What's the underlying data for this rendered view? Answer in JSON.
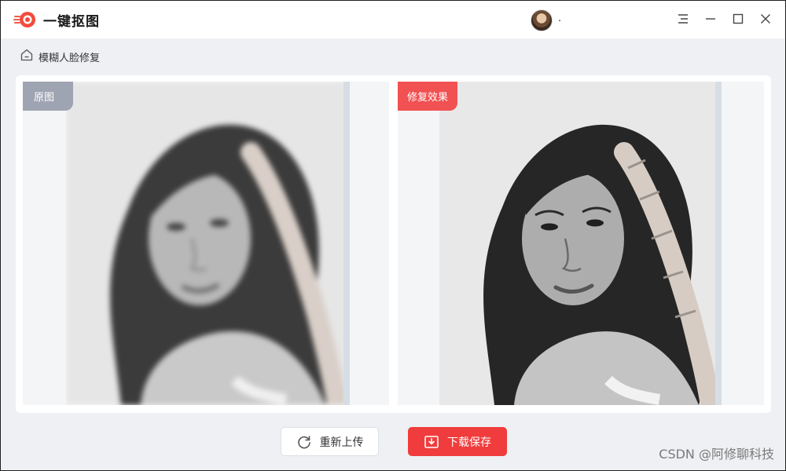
{
  "app": {
    "title": "一键抠图",
    "brand_color": "#f03c3c"
  },
  "user": {
    "name": "."
  },
  "window_controls": [
    "menu-icon",
    "minimize-icon",
    "maximize-icon",
    "close-icon"
  ],
  "breadcrumb": {
    "label": "模糊人脸修复",
    "icon": "home-icon"
  },
  "panels": {
    "original": {
      "tag": "原图",
      "tag_color": "#9fa4b2"
    },
    "result": {
      "tag": "修复效果",
      "tag_color": "#f15152"
    }
  },
  "actions": {
    "reupload_label": "重新上传",
    "save_label": "下载保存"
  },
  "watermark": "CSDN @阿修聊科技"
}
